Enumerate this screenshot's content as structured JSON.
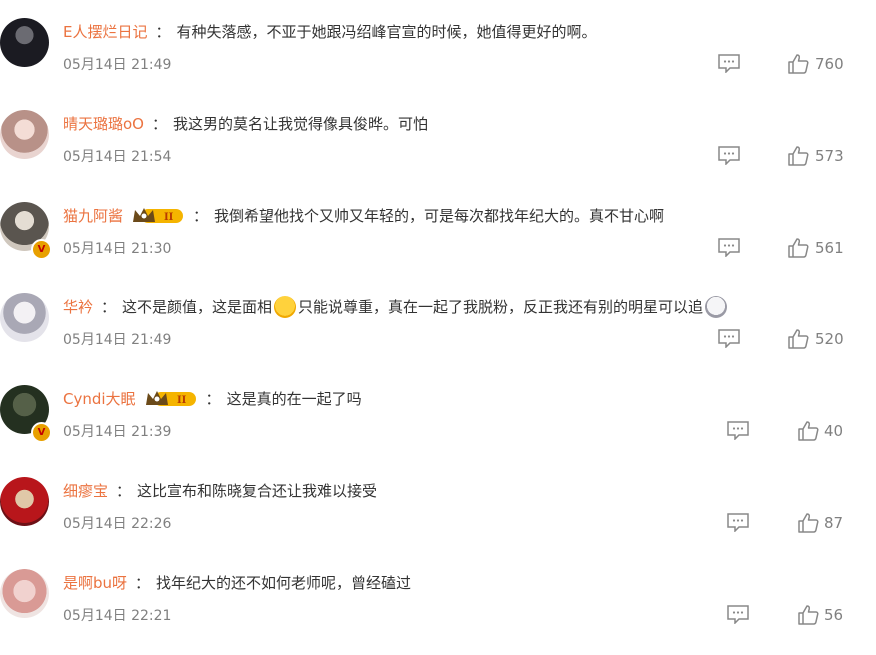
{
  "comments": [
    {
      "username": "E人摆烂日记",
      "text": "有种失落感，不亚于她跟冯绍峰官宣的时候，她值得更好的啊。",
      "time": "05月14日 21:49",
      "likes": "760"
    },
    {
      "username": "晴天璐璐oO",
      "text": "我这男的莫名让我觉得像具俊晔。可怕",
      "time": "05月14日 21:54",
      "likes": "573"
    },
    {
      "username": "猫九阿酱",
      "text": "我倒希望他找个又帅又年轻的，可是每次都找年纪大的。真不甘心啊",
      "time": "05月14日 21:30",
      "likes": "561",
      "member_level": "II"
    },
    {
      "username": "华衿",
      "text_before": "这不是颜值，这是面相",
      "text_after": "只能说尊重，真在一起了我脱粉，反正我还有别的明星可以追",
      "time": "05月14日 21:49",
      "likes": "520"
    },
    {
      "username": "Cyndi大眠",
      "text": "这是真的在一起了吗",
      "time": "05月14日 21:39",
      "likes": "40",
      "member_level": "II"
    },
    {
      "username": "细瘳宝",
      "text": "这比宣布和陈晓复合还让我难以接受",
      "time": "05月14日 22:26",
      "likes": "87"
    },
    {
      "username": "是啊bu呀",
      "text": "找年纪大的还不如何老师呢，曾经磕过",
      "time": "05月14日 22:21",
      "likes": "56"
    }
  ],
  "colon": "：",
  "verified_mark": "V",
  "icons": {
    "reply": "comment-bubble-icon",
    "like": "thumbs-up-icon",
    "emoji_1": "crying-laugh-emoji",
    "emoji_2": "shocked-ghost-emoji",
    "member": "crown-badge-icon"
  },
  "colors": {
    "username": "#eb7340",
    "text": "#333333",
    "meta": "#808080"
  }
}
